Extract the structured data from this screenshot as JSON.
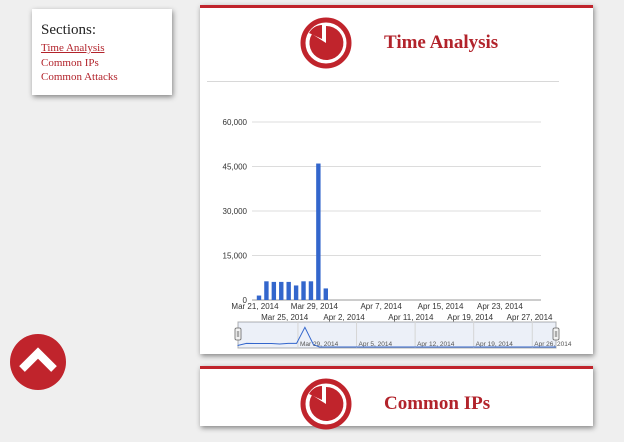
{
  "nav": {
    "title": "Sections:",
    "links": [
      "Time Analysis",
      "Common IPs",
      "Common Attacks"
    ]
  },
  "cards": [
    {
      "title": "Time Analysis"
    },
    {
      "title": "Common IPs"
    }
  ],
  "colors": {
    "accent": "#c0242c",
    "link": "#b2232b",
    "bar": "#3366cc"
  },
  "icons": {
    "logo": "pie-chart-logo-icon",
    "scroll_top": "chevron-up-icon"
  },
  "chart_data": {
    "type": "bar",
    "yticks": [
      "0",
      "15,000",
      "30,000",
      "45,000",
      "60,000"
    ],
    "ylim": [
      0,
      60000
    ],
    "xticks_top": [
      "Mar 21, 2014",
      "Mar 29, 2014",
      "Apr 7, 2014",
      "Apr 15, 2014",
      "Apr 23, 2014"
    ],
    "xticks_bottom": [
      "Mar 25, 2014",
      "Apr 2, 2014",
      "Apr 11, 2014",
      "Apr 19, 2014",
      "Apr 27, 2014"
    ],
    "x": [
      "2014-03-21",
      "2014-03-22",
      "2014-03-23",
      "2014-03-24",
      "2014-03-25",
      "2014-03-26",
      "2014-03-27",
      "2014-03-28",
      "2014-03-29",
      "2014-03-30"
    ],
    "values": [
      1500,
      6300,
      6100,
      6100,
      6100,
      4900,
      6300,
      6300,
      46000,
      3900
    ],
    "navigator_ticks": [
      "Mar 29, 2014",
      "Apr 5, 2014",
      "Apr 12, 2014",
      "Apr 19, 2014",
      "Apr 26, 2014"
    ]
  }
}
